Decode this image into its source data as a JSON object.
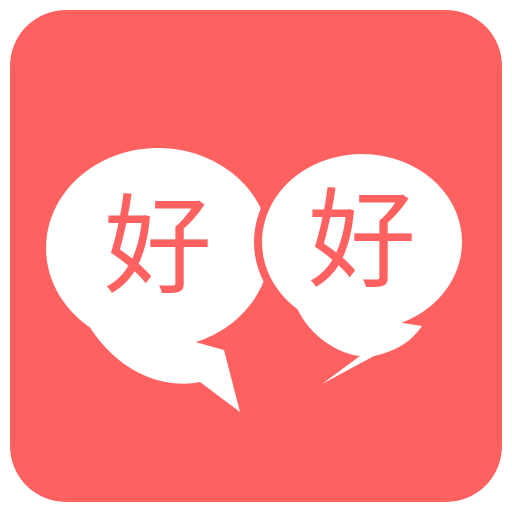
{
  "icon": {
    "name": "app-icon-haohao",
    "background_color": "#ff6161",
    "bubble_color": "#ffffff",
    "text_color": "#ff6161"
  },
  "bubbles": [
    {
      "text": "好"
    },
    {
      "text": "好"
    }
  ]
}
